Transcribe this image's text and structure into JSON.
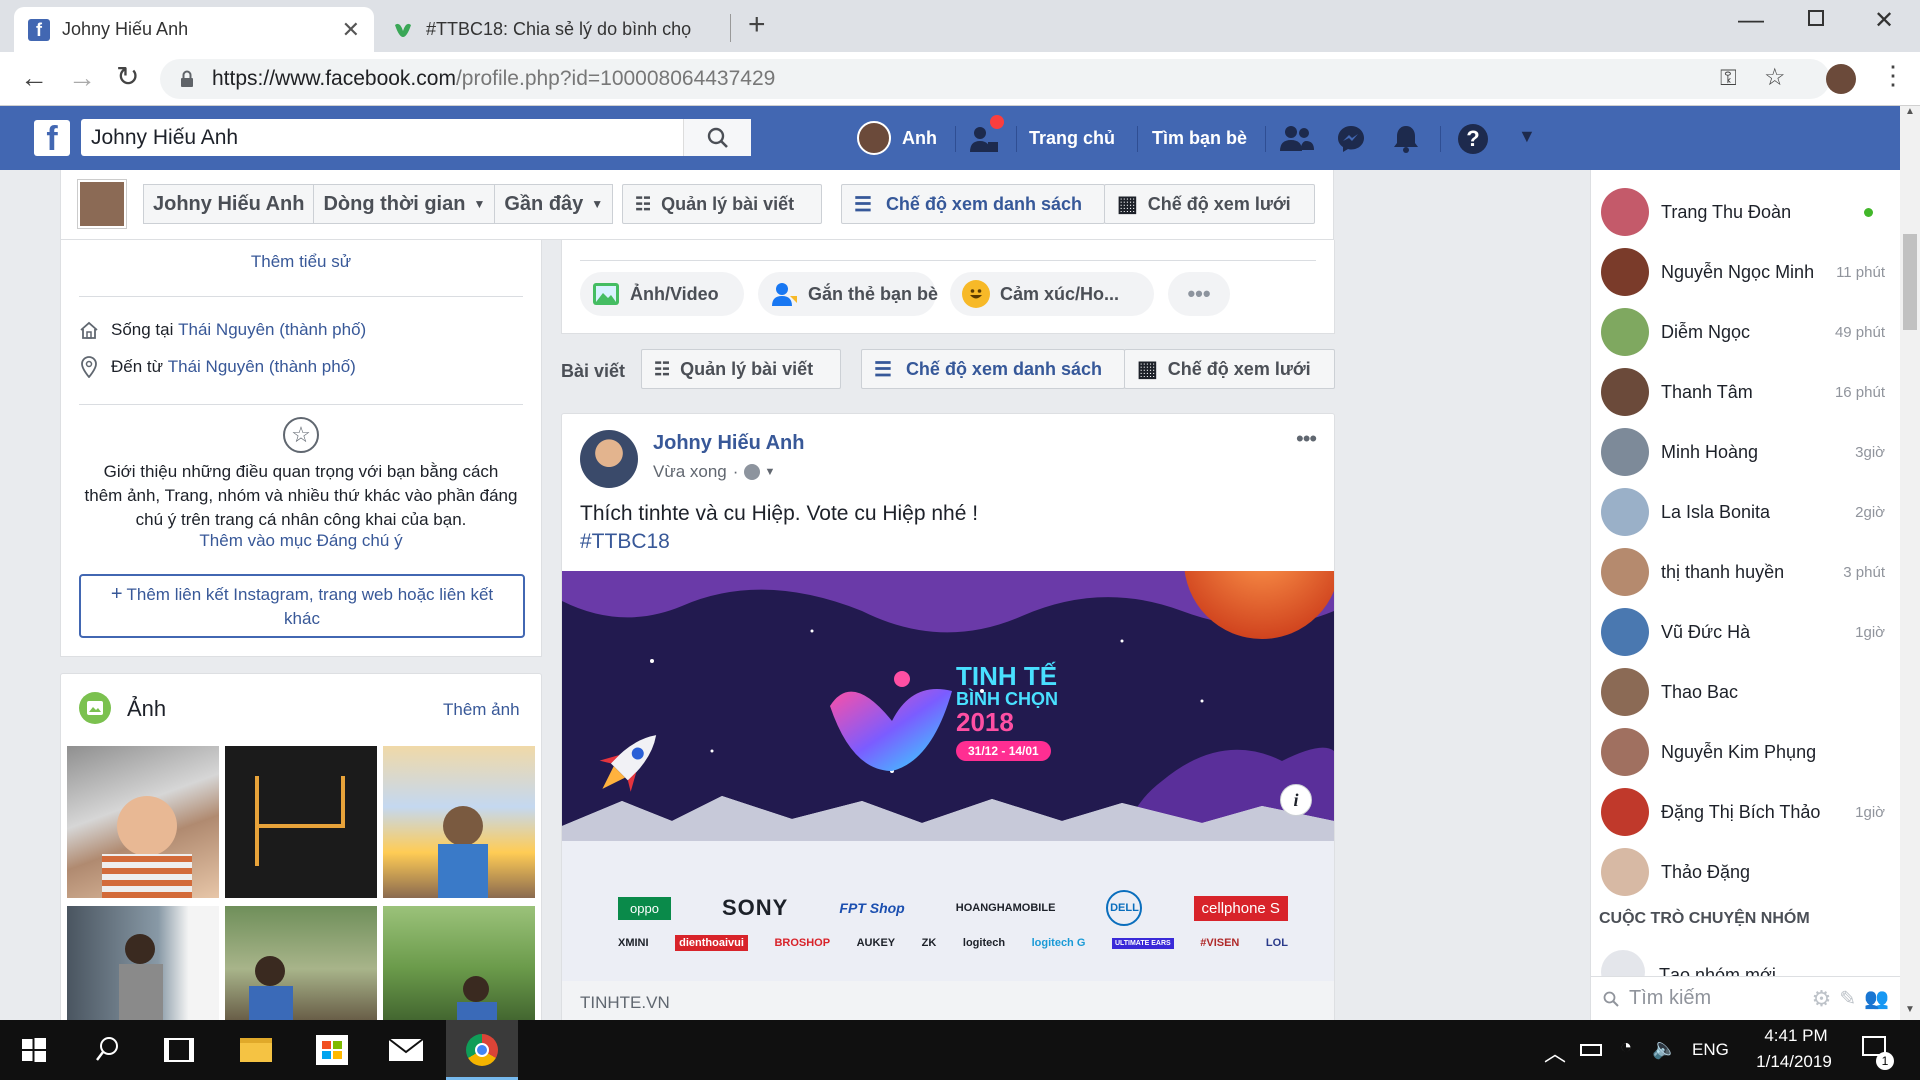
{
  "browser": {
    "tabs": [
      {
        "title": "Johny Hiếu Anh"
      },
      {
        "title": "#TTBC18: Chia sẻ lý do bình chọ"
      }
    ],
    "url_base": "https://www.facebook.com",
    "url_path": "/profile.php?id=100008064437429"
  },
  "header": {
    "search_value": "Johny Hiếu Anh",
    "profile_name": "Anh",
    "home": "Trang chủ",
    "find_friends": "Tìm bạn bè"
  },
  "timeline_bar": {
    "name": "Johny Hiếu Anh",
    "timeline": "Dòng thời gian",
    "recent": "Gần đây",
    "manage_posts": "Quản lý bài viết",
    "list_view": "Chế độ xem danh sách",
    "grid_view": "Chế độ xem lưới"
  },
  "intro": {
    "edit_bio": "Thêm tiểu sử",
    "lives_prefix": "Sống tại",
    "lives_city": "Thái Nguyên (thành phố)",
    "from_prefix": "Đến từ",
    "from_city": "Thái Nguyên (thành phố)",
    "featured_text": "Giới thiệu những điều quan trọng với bạn bằng cách thêm ảnh, Trang, nhóm và nhiều thứ khác vào phần đáng chú ý trên trang cá nhân công khai của bạn.",
    "featured_link": "Thêm vào mục Đáng chú ý",
    "add_links": "Thêm liên kết Instagram, trang web hoặc liên kết khác"
  },
  "photos": {
    "title": "Ảnh",
    "add": "Thêm ảnh"
  },
  "composer": {
    "photo_video": "Ảnh/Video",
    "tag_friends": "Gắn thẻ bạn bè",
    "feeling": "Cảm xúc/Ho..."
  },
  "posts_bar": {
    "label": "Bài viết",
    "manage_posts": "Quản lý bài viết",
    "list_view": "Chế độ xem danh sách",
    "grid_view": "Chế độ xem lưới"
  },
  "post": {
    "author": "Johny Hiếu Anh",
    "time": "Vừa xong",
    "text": "Thích tinhte và cu Hiệp. Vote cu Hiệp nhé !",
    "hashtag": "#TTBC18",
    "banner_title1": "TINH TẾ",
    "banner_title2": "BÌNH CHỌN",
    "banner_year": "2018",
    "banner_dates": "31/12 - 14/01",
    "sponsors_row1": [
      "oppo",
      "SONY",
      "FPT Shop",
      "HOANGHAMOBILE",
      "DELL",
      "cellphone S"
    ],
    "sponsors_row2": [
      "XMINI",
      "dienthoaivui",
      "BROSHOP",
      "AUKEY",
      "ZK",
      "logitech",
      "logitech G",
      "ULTIMATE EARS",
      "#VISEN",
      "LOL"
    ],
    "source": "TINHTE.VN"
  },
  "chat": {
    "contacts": [
      {
        "name": "Trang Thu Đoàn",
        "time": "",
        "online": true,
        "color": "#c45a6a"
      },
      {
        "name": "Nguyễn Ngọc Minh",
        "time": "11 phút",
        "online": false,
        "color": "#7a3b2a"
      },
      {
        "name": "Diễm Ngọc",
        "time": "49 phút",
        "online": false,
        "color": "#7fa860"
      },
      {
        "name": "Thanh Tâm",
        "time": "16 phút",
        "online": false,
        "color": "#6b4a3a"
      },
      {
        "name": "Minh Hoàng",
        "time": "3giờ",
        "online": false,
        "color": "#7d8a99"
      },
      {
        "name": "La Isla Bonita",
        "time": "2giờ",
        "online": false,
        "color": "#9ab0c8"
      },
      {
        "name": "thị thanh huyền",
        "time": "3 phút",
        "online": false,
        "color": "#b58a6e"
      },
      {
        "name": "Vũ Đức Hà",
        "time": "1giờ",
        "online": false,
        "color": "#4a78b0"
      },
      {
        "name": "Thao Bac",
        "time": "",
        "online": false,
        "color": "#8b6a55"
      },
      {
        "name": "Nguyễn Kim Phụng",
        "time": "",
        "online": false,
        "color": "#a07060"
      },
      {
        "name": "Đặng Thị Bích Thảo",
        "time": "1giờ",
        "online": false,
        "color": "#c0392b"
      },
      {
        "name": "Thảo Đặng",
        "time": "",
        "online": false,
        "color": "#d7b9a4"
      }
    ],
    "group_header": "CUỘC TRÒ CHUYỆN NHÓM",
    "new_group": "Tạo nhóm mới",
    "search_placeholder": "Tìm kiếm"
  },
  "taskbar": {
    "lang": "ENG",
    "time": "4:41 PM",
    "date": "1/14/2019",
    "notif_count": "1"
  },
  "colors": {
    "fb_blue": "#4267b2",
    "link": "#385898",
    "online": "#42b72a"
  }
}
